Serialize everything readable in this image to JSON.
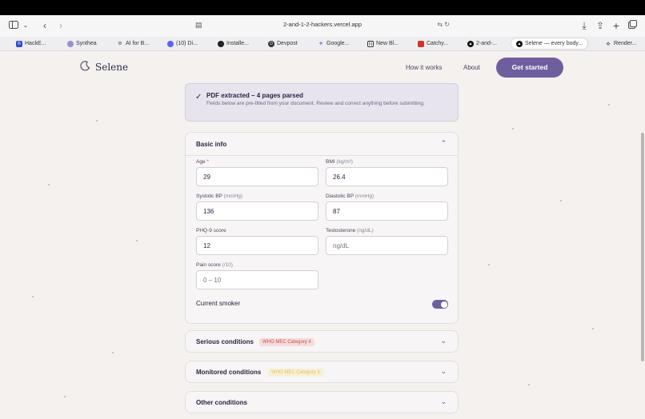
{
  "browser": {
    "url": "2-and-1-2-hackers.vercel.app",
    "bookmarks": [
      {
        "label": "HackE...",
        "icon": "hacker-icon",
        "color": "#2d4bd1"
      },
      {
        "label": "Synthea",
        "icon": "synthea-icon",
        "color": "#9b8fd0"
      },
      {
        "label": "AI for B...",
        "icon": "gear-icon",
        "color": "#555555"
      },
      {
        "label": "(10) Di...",
        "icon": "discord-icon",
        "color": "#5865f2"
      },
      {
        "label": "Installe...",
        "icon": "github-icon",
        "color": "#222222"
      },
      {
        "label": "Devpost",
        "icon": "devpost-icon",
        "color": "#333333"
      },
      {
        "label": "Google...",
        "icon": "gemini-icon",
        "color": "#7a8ad8"
      },
      {
        "label": "New Bl...",
        "icon": "notion-icon",
        "color": "#333333"
      },
      {
        "label": "Catchy...",
        "icon": "catchy-icon",
        "color": "#d0322c"
      },
      {
        "label": "2-and-...",
        "icon": "vercel-icon",
        "color": "#111111"
      },
      {
        "label": "Selene — every body...",
        "icon": "vercel-icon",
        "color": "#111111"
      },
      {
        "label": "Render...",
        "icon": "render-icon",
        "color": "#111111"
      }
    ]
  },
  "header": {
    "brand": "Selene",
    "nav": [
      "How it works",
      "About"
    ],
    "cta": "Get started"
  },
  "notice": {
    "title": "PDF extracted – 4 pages parsed",
    "body": "Fields below are pre-filled from your document. Review and correct anything before submitting."
  },
  "basic_info": {
    "title": "Basic info",
    "fields": {
      "age": {
        "label": "Age",
        "required_mark": "*",
        "value": "29"
      },
      "bmi": {
        "label": "BMI",
        "unit": "(kg/m²)",
        "value": "26.4"
      },
      "systolic": {
        "label": "Systolic BP",
        "unit": "(mmHg)",
        "value": "136"
      },
      "diastolic": {
        "label": "Diastolic BP",
        "unit": "(mmHg)",
        "value": "87"
      },
      "phq9": {
        "label": "PHQ-9 score",
        "value": "12"
      },
      "testosterone": {
        "label": "Testosterone",
        "unit": "(ng/dL)",
        "placeholder": "ng/dL"
      },
      "pain": {
        "label": "Pain score",
        "unit": "(/10)",
        "placeholder": "0 – 10"
      }
    },
    "smoker": {
      "label": "Current smoker",
      "on": true
    }
  },
  "sections": [
    {
      "title": "Serious conditions",
      "badge": "WHO MEC Category 4",
      "badge_color": "#c0504d"
    },
    {
      "title": "Monitored conditions",
      "badge": "WHO MEC Category 3",
      "badge_color": "#e0c358"
    },
    {
      "title": "Other conditions"
    }
  ]
}
